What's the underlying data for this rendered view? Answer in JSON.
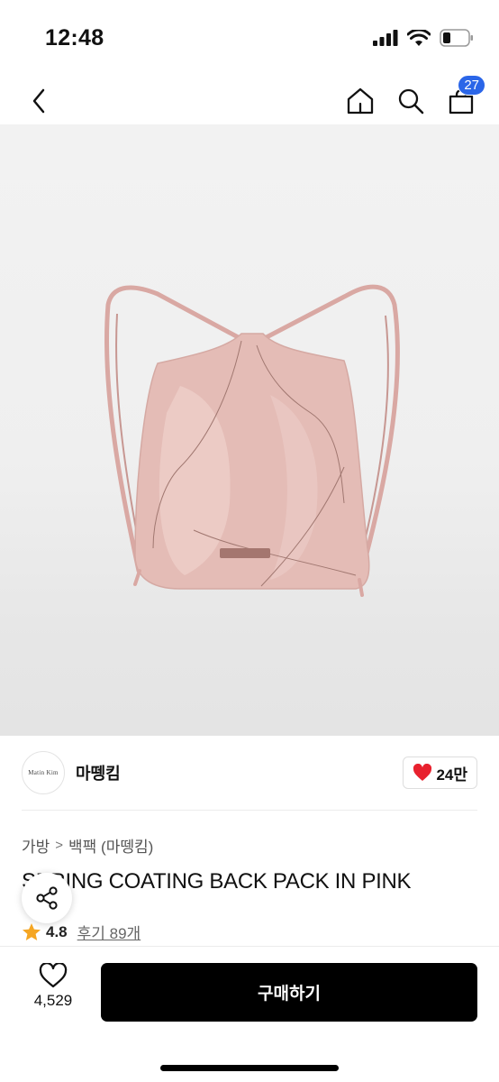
{
  "status_bar": {
    "time": "12:48"
  },
  "nav": {
    "cart_count": "27"
  },
  "brand": {
    "logo_text": "Matin Kim",
    "name": "마뗑킴",
    "like_count": "24만"
  },
  "breadcrumb": {
    "category": "가방",
    "separator": ">",
    "subcategory": "백팩 (마뗑킴)"
  },
  "product": {
    "title": "SPRING COATING BACK PACK IN PINK",
    "rating": "4.8",
    "review_label": "후기 89개"
  },
  "bottom": {
    "wish_count": "4,529",
    "buy_label": "구매하기"
  },
  "colors": {
    "accent_blue": "#2b66e8",
    "heart_red": "#e8212e",
    "star_orange": "#f5a623",
    "buy_bg": "#000000",
    "bag_pink": "#e2b8b3"
  },
  "icons": [
    "signal-icon",
    "wifi-icon",
    "battery-icon",
    "back-icon",
    "home-icon",
    "search-icon",
    "cart-icon",
    "heart-icon",
    "share-icon",
    "star-icon",
    "heart-outline-icon"
  ]
}
